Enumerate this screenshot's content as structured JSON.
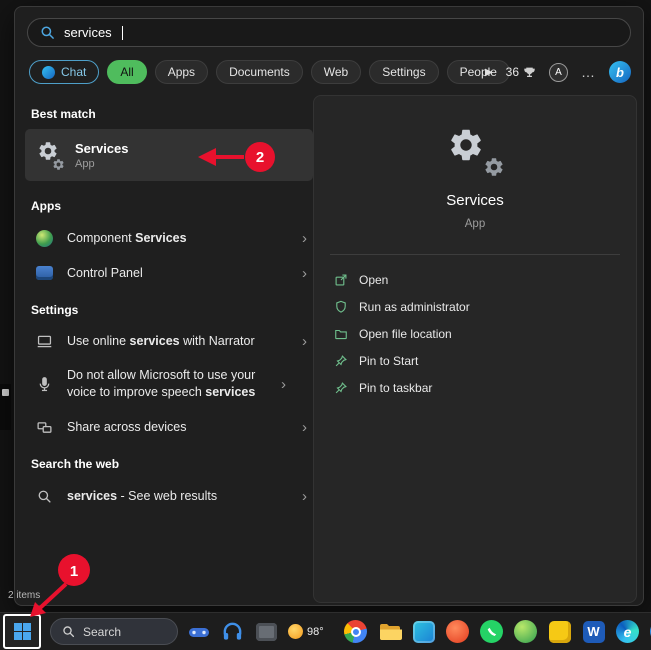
{
  "colors": {
    "annotation_red": "#e8112d",
    "selected_filter_green": "#4fbc5d",
    "accent_action": "#6fbe8c",
    "search_icon_blue": "#4da6e0"
  },
  "icons": {
    "chevron": "›",
    "play": "▶",
    "more": "…",
    "bing_letter": "b"
  },
  "search_bar": {
    "value": "services"
  },
  "filter_bar": {
    "chat_label": "Chat",
    "tabs": [
      {
        "label": "All"
      },
      {
        "label": "Apps"
      },
      {
        "label": "Documents"
      },
      {
        "label": "Web"
      },
      {
        "label": "Settings"
      },
      {
        "label": "People"
      }
    ],
    "rewards_points": "36",
    "avatar_letter": "A"
  },
  "results": {
    "best_match_heading": "Best match",
    "best_match": {
      "title": "Services",
      "subtitle": "App"
    },
    "apps_heading": "Apps",
    "apps": [
      {
        "pre": "Component ",
        "match": "Services",
        "post": ""
      },
      {
        "pre": "Control Panel",
        "match": "",
        "post": ""
      }
    ],
    "settings_heading": "Settings",
    "settings": [
      {
        "pre": "Use online ",
        "match": "services",
        "post": " with Narrator"
      },
      {
        "pre": "Do not allow Microsoft to use your voice to improve speech ",
        "match": "services",
        "post": ""
      },
      {
        "pre": "Share across devices",
        "match": "",
        "post": ""
      }
    ],
    "web_heading": "Search the web",
    "web": [
      {
        "pre": "",
        "match": "services",
        "post": " - See web results"
      }
    ]
  },
  "preview": {
    "title": "Services",
    "subtitle": "App",
    "actions": [
      {
        "label": "Open"
      },
      {
        "label": "Run as administrator"
      },
      {
        "label": "Open file location"
      },
      {
        "label": "Pin to Start"
      },
      {
        "label": "Pin to taskbar"
      }
    ]
  },
  "annotations": {
    "step1": "1",
    "step2": "2"
  },
  "explorer_status": "2 items",
  "taskbar": {
    "search_label": "Search",
    "weather_temp": "98°",
    "word_letter": "W",
    "edge_letter": "e"
  }
}
